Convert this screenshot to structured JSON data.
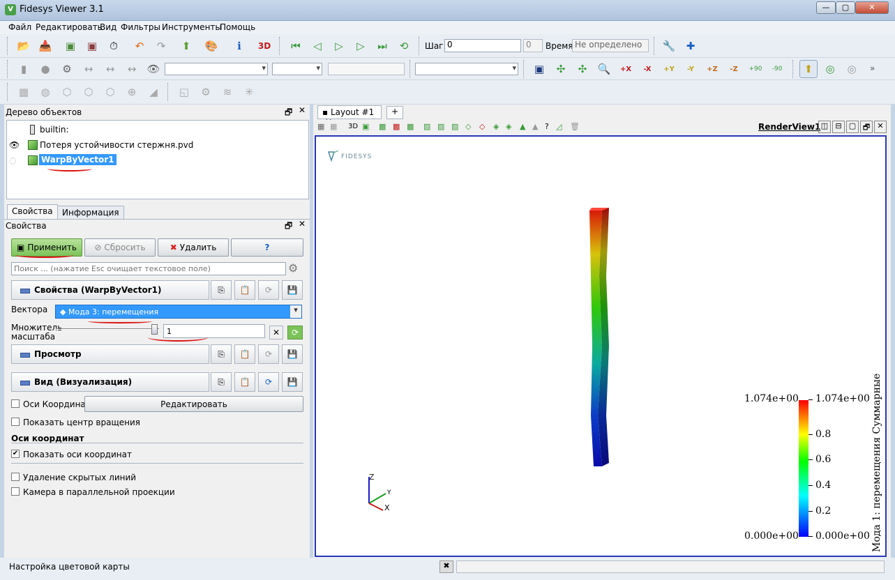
{
  "window": {
    "title": "Fidesys Viewer 3.1"
  },
  "menu": [
    "Файл",
    "Редактировать",
    "Вид",
    "Фильтры",
    "Инструменты",
    "Помощь"
  ],
  "toolbar": {
    "step_label": "Шаг:",
    "step_value": "0",
    "step_max": "0",
    "time_label": "Время:",
    "time_value": "Не определено",
    "icon_3d": "3D",
    "plus_x": "+X",
    "minus_x": "-X",
    "plus_y": "+Y",
    "minus_y": "-Y",
    "plus_z": "+Z",
    "minus_z": "-Z",
    "rot_plus": "+90",
    "rot_minus": "-90"
  },
  "pipeline": {
    "header": "Дерево объектов",
    "items": [
      {
        "label": "builtin:"
      },
      {
        "label": "Потеря устойчивости стержня.pvd"
      },
      {
        "label": "WarpByVector1"
      }
    ]
  },
  "tabs": [
    "Свойства",
    "Информация"
  ],
  "properties": {
    "header": "Свойства",
    "apply": "Применить",
    "reset": "Сбросить",
    "delete": "Удалить",
    "help": "?",
    "search_placeholder": "Поиск ... (нажатие Esc очищает текстовое поле)",
    "section_props": "Свойства (WarpByVector1)",
    "vectors_label": "Вектора",
    "vectors_value": "Мода 3: перемещения",
    "scale_label_1": "Множитель",
    "scale_label_2": "масштаба",
    "scale_value": "1",
    "section_view": "Просмотр",
    "section_display": "Вид (Визуализация)",
    "axes_label": "Оси Координат",
    "edit_button": "Редактировать",
    "show_center": "Показать центр вращения",
    "group_axes": "Оси координат",
    "show_axes": "Показать оси координат",
    "show_axes_checked": true,
    "hidden_lines": "Удаление скрытых линий",
    "parallel_proj": "Камера в параллельной проекции"
  },
  "layout": {
    "tab": "Layout #1",
    "add_tab": "+",
    "view_name": "RenderView1",
    "mode_3d": "3D"
  },
  "render": {
    "logo": "FIDESYS",
    "axes": {
      "z": "Z",
      "y": "Y",
      "x": "X"
    },
    "colorbar": {
      "title": "Мода 1: перемещения Суммарные",
      "ticks": [
        "1.074e+00",
        "0.8",
        "0.6",
        "0.4",
        "0.2",
        "0.000e+00"
      ],
      "left_max": "1.074e+00",
      "left_min": "0.000e+00",
      "colors": [
        "#ff0000",
        "#ffff00",
        "#00ff00",
        "#00ffff",
        "#0000ff"
      ]
    }
  },
  "status": {
    "text": "Настройка цветовой карты"
  }
}
